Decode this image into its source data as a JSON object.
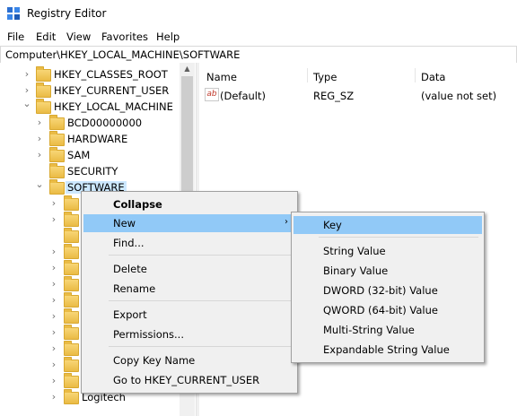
{
  "window": {
    "title": "Registry Editor"
  },
  "menubar": {
    "items": [
      "File",
      "Edit",
      "View",
      "Favorites",
      "Help"
    ]
  },
  "address": {
    "path": "Computer\\HKEY_LOCAL_MACHINE\\SOFTWARE"
  },
  "tree": {
    "items": [
      {
        "label": "HKEY_CLASSES_ROOT",
        "expander": "›"
      },
      {
        "label": "HKEY_CURRENT_USER",
        "expander": "›"
      },
      {
        "label": "HKEY_LOCAL_MACHINE",
        "expander": "⌄"
      },
      {
        "label": "BCD00000000",
        "expander": "›"
      },
      {
        "label": "HARDWARE",
        "expander": "›"
      },
      {
        "label": "SAM",
        "expander": "›"
      },
      {
        "label": "SECURITY",
        "expander": ""
      },
      {
        "label": "SOFTWARE",
        "expander": "⌄"
      },
      {
        "label": "Logitech",
        "expander": "›"
      }
    ]
  },
  "list": {
    "columns": {
      "name": "Name",
      "type": "Type",
      "data": "Data"
    },
    "rows": [
      {
        "icon": "ab",
        "name": "(Default)",
        "type": "REG_SZ",
        "data": "(value not set)"
      }
    ]
  },
  "context_menu": {
    "collapse": "Collapse",
    "new": "New",
    "new_arrow": "›",
    "find": "Find...",
    "delete": "Delete",
    "rename": "Rename",
    "export": "Export",
    "permissions": "Permissions...",
    "copy_key_name": "Copy Key Name",
    "goto": "Go to HKEY_CURRENT_USER"
  },
  "submenu": {
    "key": "Key",
    "string_value": "String Value",
    "binary_value": "Binary Value",
    "dword_value": "DWORD (32-bit) Value",
    "qword_value": "QWORD (64-bit) Value",
    "multi_string_value": "Multi-String Value",
    "expandable_string_value": "Expandable String Value"
  },
  "colors": {
    "highlight": "#91c9f7",
    "tree_selection": "#cce8ff",
    "menu_background": "#f0f0f0",
    "folder": "#eabb45"
  }
}
